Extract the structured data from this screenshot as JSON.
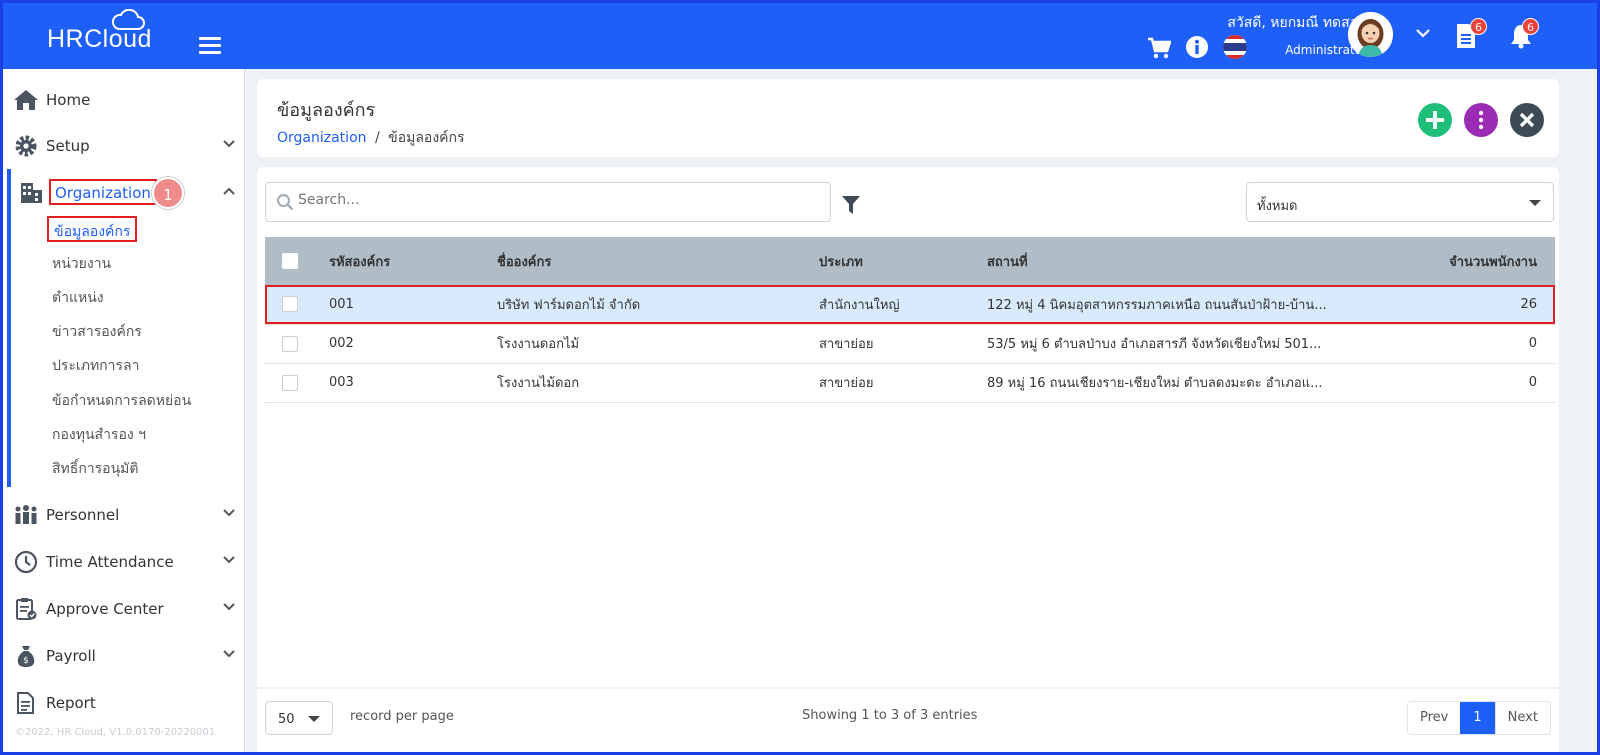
{
  "header": {
    "logo": "HRCloud",
    "greeting": "สวัสดี, หยกมณี ทดสอบ",
    "role": "Administrator",
    "documents_badge": "6",
    "notifications_badge": "6"
  },
  "sidebar": {
    "items": [
      {
        "label": "Home",
        "icon": "home-icon"
      },
      {
        "label": "Setup",
        "icon": "gear-icon"
      },
      {
        "label": "Organization",
        "icon": "building-icon"
      },
      {
        "label": "Personnel",
        "icon": "people-icon"
      },
      {
        "label": "Time Attendance",
        "icon": "clock-icon"
      },
      {
        "label": "Approve Center",
        "icon": "clipboard-icon"
      },
      {
        "label": "Payroll",
        "icon": "money-bag-icon"
      },
      {
        "label": "Report",
        "icon": "report-icon"
      }
    ],
    "step_badge": "1",
    "organization_subitems": [
      "ข้อมูลองค์กร",
      "หน่วยงาน",
      "ตำแหน่ง",
      "ข่าวสารองค์กร",
      "ประเภทการลา",
      "ข้อกำหนดการลดหย่อน",
      "กองทุนสำรอง ฯ",
      "สิทธิ์การอนุมัติ"
    ],
    "copyright": "©2022, HR Cloud, V1.0.0170-20220001"
  },
  "page": {
    "title": "ข้อมูลองค์กร",
    "breadcrumb_link": "Organization",
    "breadcrumb_sep": "/",
    "breadcrumb_current": "ข้อมูลองค์กร"
  },
  "toolbar": {
    "search_placeholder": "Search...",
    "type_filter": "ทั้งหมด"
  },
  "table": {
    "columns": [
      "รหัสองค์กร",
      "ชื่อองค์กร",
      "ประเภท",
      "สถานที่",
      "จำนวนพนักงาน"
    ],
    "rows": [
      {
        "code": "001",
        "name": "บริษัท ฟาร์มดอกไม้ จำกัด",
        "type": "สำนักงานใหญ่",
        "location": "122 หมู่ 4 นิคมอุตสาหกรรมภาคเหนือ ถนนสันป่าฝ้าย-บ้าน...",
        "count": "26"
      },
      {
        "code": "002",
        "name": "โรงงานดอกไม้",
        "type": "สาขาย่อย",
        "location": "53/5 หมู่ 6 ตำบลป่าบง อำเภอสารภี จังหวัดเชียงใหม่ 501...",
        "count": "0"
      },
      {
        "code": "003",
        "name": "โรงงานไม้ดอก",
        "type": "สาขาย่อย",
        "location": "89 หมู่ 16 ถนนเชียงราย-เชียงใหม่ ตำบลดงมะดะ อำเภอแ...",
        "count": "0"
      }
    ]
  },
  "footer": {
    "per_page": "50",
    "per_page_label": "record per page",
    "showing": "Showing 1 to 3 of 3 entries",
    "prev": "Prev",
    "current_page": "1",
    "next": "Next"
  },
  "colors": {
    "brand": "#1e5ff7",
    "add": "#1fbf7a",
    "more": "#9b2bb5",
    "close": "#3e4a55",
    "highlight": "#e02020"
  }
}
